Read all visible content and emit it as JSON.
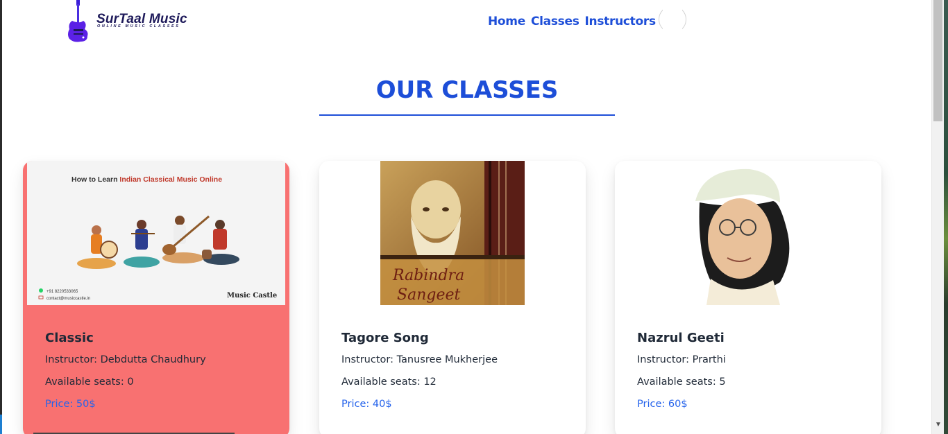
{
  "brand": {
    "name": "SurTaal Music",
    "tagline": "ONLINE MUSIC CLASSES"
  },
  "nav": {
    "items": [
      "Home",
      "Classes",
      "Instructors"
    ]
  },
  "page": {
    "title": "OUR CLASSES"
  },
  "classes": [
    {
      "title": "Classic",
      "instructor_label": "Instructor: Debdutta Chaudhury",
      "seats_label": "Available seats: 0",
      "price_label": "Price: 50$",
      "image": {
        "heading_prefix": "How to Learn ",
        "heading_highlight": "Indian Classical Music Online",
        "phone": "+91 8220533065",
        "email": "contact@musiccastle.in",
        "brand": "Music Castle"
      },
      "sold_out": true
    },
    {
      "title": "Tagore Song",
      "instructor_label": "Instructor: Tanusree Mukherjee",
      "seats_label": "Available seats: 12",
      "price_label": "Price: 40$",
      "image": {
        "caption_line1": "Rabindra",
        "caption_line2": "Sangeet"
      },
      "sold_out": false
    },
    {
      "title": "Nazrul Geeti",
      "instructor_label": "Instructor: Prarthi",
      "seats_label": "Available seats: 5",
      "price_label": "Price: 60$",
      "image": {},
      "sold_out": false
    }
  ],
  "colors": {
    "accent": "#1d4ed8",
    "sold_out_card": "#f87171",
    "price": "#2563eb"
  }
}
